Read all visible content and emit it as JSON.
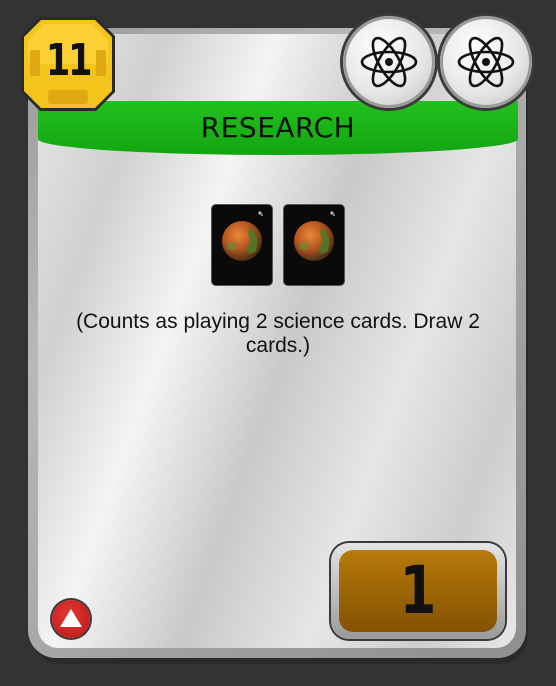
{
  "card": {
    "title": "RESEARCH",
    "cost": "11",
    "description": "(Counts as playing 2 science cards. Draw 2 cards.)",
    "victory_points": "1",
    "science_symbols": [
      "atom-icon",
      "atom-icon"
    ],
    "pictured_cards": [
      "planet-card",
      "planet-card"
    ],
    "type_indicator_icon": "warning-triangle-icon"
  },
  "colors": {
    "banner": "#13a511",
    "cost_badge": "#f3c51b",
    "victory_box": "#9a6405",
    "warning": "#c81e1e",
    "background": "#333333"
  }
}
